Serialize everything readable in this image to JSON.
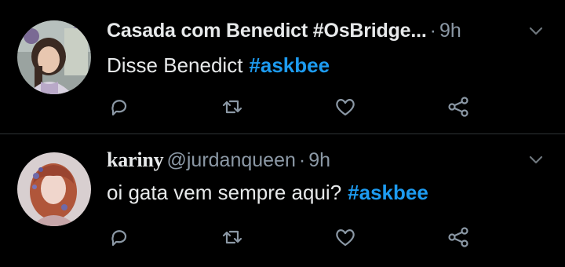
{
  "tweets": [
    {
      "display_name": "Casada com Benedict #OsBridge...",
      "handle": "",
      "separator": "·",
      "time": "9h",
      "text": "Disse Benedict",
      "hashtag": "#askbee",
      "avatar_icon": "profile-photo-woman-dark-hair"
    },
    {
      "display_name": "kariny",
      "handle": "@jurdanqueen",
      "separator": "·",
      "time": "9h",
      "text": "oi gata vem sempre aqui?",
      "hashtag": "#askbee",
      "avatar_icon": "profile-photo-woman-red-hair"
    }
  ],
  "actions": [
    "reply-icon",
    "retweet-icon",
    "like-icon",
    "share-icon"
  ],
  "colors": {
    "background": "#000000",
    "primary_text": "#e7e9ea",
    "secondary_text": "#8b98a5",
    "hashtag": "#1d9bf0",
    "divider": "#2f3336"
  }
}
